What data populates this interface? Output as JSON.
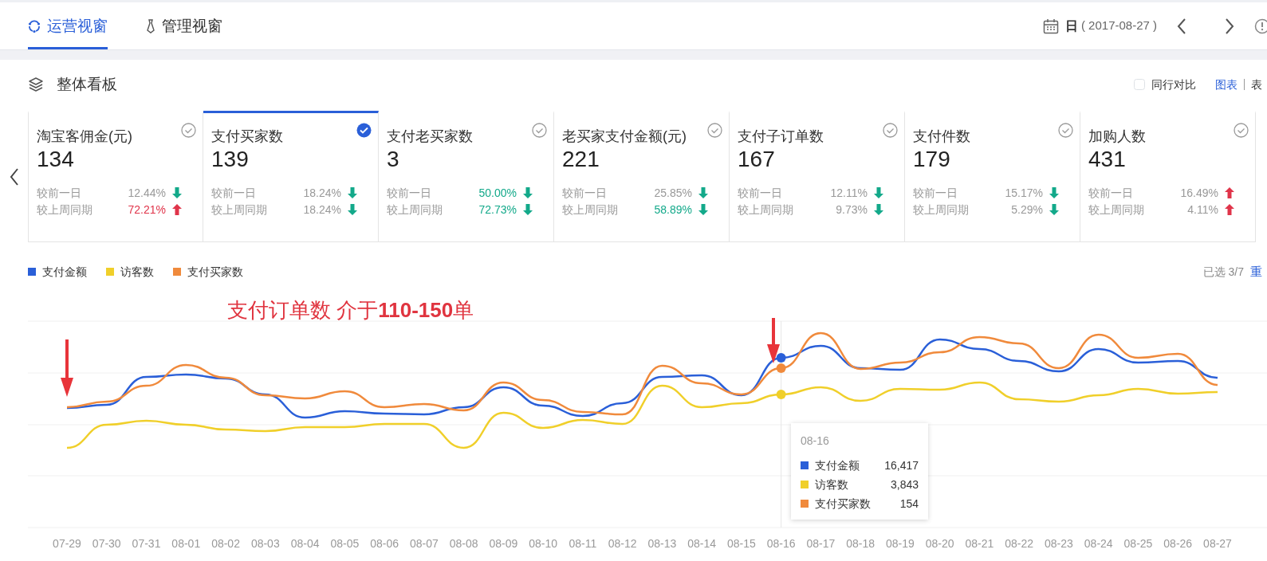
{
  "tabs": [
    {
      "label": "运营视窗",
      "selected": true
    },
    {
      "label": "管理视窗",
      "selected": false
    }
  ],
  "date_picker": {
    "period": "日",
    "date": "( 2017-08-27 )"
  },
  "panel": {
    "title": "整体看板",
    "compare_checkbox": {
      "label": "同行对比",
      "checked": false
    },
    "view_links": [
      {
        "label": "图表",
        "selected": true
      },
      {
        "label": "表",
        "selected": false
      }
    ]
  },
  "metrics": [
    {
      "title": "淘宝客佣金(元)",
      "value": "134",
      "selected": false,
      "compare": [
        {
          "label": "较前一日",
          "value": "12.44%",
          "rising": false,
          "emphasized": false
        },
        {
          "label": "较上周同期",
          "value": "72.21%",
          "rising": true,
          "emphasized": true
        }
      ]
    },
    {
      "title": "支付买家数",
      "value": "139",
      "selected": true,
      "compare": [
        {
          "label": "较前一日",
          "value": "18.24%",
          "rising": false,
          "emphasized": false
        },
        {
          "label": "较上周同期",
          "value": "18.24%",
          "rising": false,
          "emphasized": false
        }
      ]
    },
    {
      "title": "支付老买家数",
      "value": "3",
      "selected": false,
      "compare": [
        {
          "label": "较前一日",
          "value": "50.00%",
          "rising": false,
          "emphasized": true
        },
        {
          "label": "较上周同期",
          "value": "72.73%",
          "rising": false,
          "emphasized": true
        }
      ]
    },
    {
      "title": "老买家支付金额(元)",
      "value": "221",
      "selected": false,
      "compare": [
        {
          "label": "较前一日",
          "value": "25.85%",
          "rising": false,
          "emphasized": false
        },
        {
          "label": "较上周同期",
          "value": "58.89%",
          "rising": false,
          "emphasized": true
        }
      ]
    },
    {
      "title": "支付子订单数",
      "value": "167",
      "selected": false,
      "compare": [
        {
          "label": "较前一日",
          "value": "12.11%",
          "rising": false,
          "emphasized": false
        },
        {
          "label": "较上周同期",
          "value": "9.73%",
          "rising": false,
          "emphasized": false
        }
      ]
    },
    {
      "title": "支付件数",
      "value": "179",
      "selected": false,
      "compare": [
        {
          "label": "较前一日",
          "value": "15.17%",
          "rising": false,
          "emphasized": false
        },
        {
          "label": "较上周同期",
          "value": "5.29%",
          "rising": false,
          "emphasized": false
        }
      ]
    },
    {
      "title": "加购人数",
      "value": "431",
      "selected": false,
      "compare": [
        {
          "label": "较前一日",
          "value": "16.49%",
          "rising": true,
          "emphasized": false
        },
        {
          "label": "较上周同期",
          "value": "4.11%",
          "rising": true,
          "emphasized": false
        }
      ]
    }
  ],
  "chart": {
    "legend": [
      {
        "name": "支付金额",
        "color": "#2a5fd8"
      },
      {
        "name": "访客数",
        "color": "#f0cf2a"
      },
      {
        "name": "支付买家数",
        "color": "#f08a3c"
      }
    ],
    "selection_count": "已选 3/7",
    "reset_link": "重",
    "annotation": "支付订单数 介于**110-150**单",
    "x_labels": [
      "07-29",
      "07-30",
      "07-31",
      "08-01",
      "08-02",
      "08-03",
      "08-04",
      "08-05",
      "08-06",
      "08-07",
      "08-08",
      "08-09",
      "08-10",
      "08-11",
      "08-12",
      "08-13",
      "08-14",
      "08-15",
      "08-16",
      "08-17",
      "08-18",
      "08-19",
      "08-20",
      "08-21",
      "08-22",
      "08-23",
      "08-24",
      "08-25",
      "08-26",
      "08-27"
    ],
    "tooltip": {
      "date": "08-16",
      "rows": [
        {
          "name": "支付金额",
          "value": "16,417",
          "color": "#2a5fd8"
        },
        {
          "name": "访客数",
          "value": "3,843",
          "color": "#f0cf2a"
        },
        {
          "name": "支付买家数",
          "value": "154",
          "color": "#f08a3c"
        }
      ]
    }
  }
}
